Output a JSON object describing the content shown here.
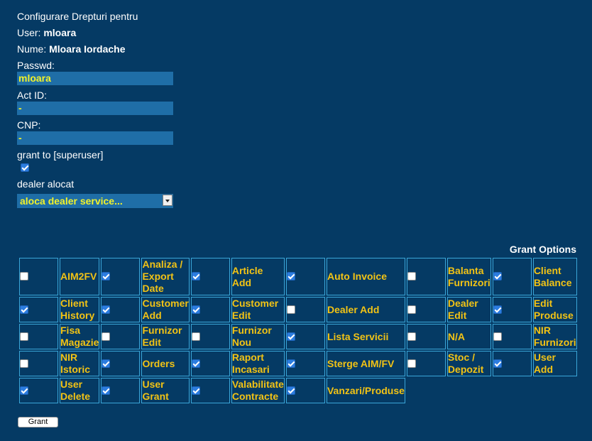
{
  "form": {
    "heading": "Configurare Drepturi pentru",
    "user_label": "User:",
    "user_value": "mloara",
    "name_label": "Nume:",
    "name_value": "Mloara Iordache",
    "passwd_label": "Passwd:",
    "passwd_value": "mloara",
    "actid_label": "Act ID:",
    "actid_value": "-",
    "cnp_label": "CNP:",
    "cnp_value": "-",
    "superuser_label": "grant to [superuser]",
    "superuser_checked": true,
    "dealer_label": "dealer alocat",
    "dealer_selected": "aloca dealer service..."
  },
  "grant_options": {
    "title": "Grant Options",
    "rows": [
      [
        {
          "label": "AIM2FV",
          "checked": false
        },
        {
          "label": "Analiza / Export Date",
          "checked": true
        },
        {
          "label": "Article Add",
          "checked": true
        },
        {
          "label": "Auto Invoice",
          "checked": true
        },
        {
          "label": "Balanta Furnizori",
          "checked": false
        },
        {
          "label": "Client Balance",
          "checked": true
        }
      ],
      [
        {
          "label": "Client History",
          "checked": true
        },
        {
          "label": "Customer Add",
          "checked": true
        },
        {
          "label": "Customer Edit",
          "checked": true
        },
        {
          "label": "Dealer Add",
          "checked": false
        },
        {
          "label": "Dealer Edit",
          "checked": false
        },
        {
          "label": "Edit Produse",
          "checked": true
        }
      ],
      [
        {
          "label": "Fisa Magazie",
          "checked": false
        },
        {
          "label": "Furnizor Edit",
          "checked": false
        },
        {
          "label": "Furnizor Nou",
          "checked": false
        },
        {
          "label": "Lista Servicii",
          "checked": true
        },
        {
          "label": "N/A",
          "checked": false
        },
        {
          "label": "NIR Furnizori",
          "checked": false
        }
      ],
      [
        {
          "label": "NIR Istoric",
          "checked": false
        },
        {
          "label": "Orders",
          "checked": true
        },
        {
          "label": "Raport Incasari",
          "checked": true
        },
        {
          "label": "Sterge AIM/FV",
          "checked": true
        },
        {
          "label": "Stoc / Depozit",
          "checked": false
        },
        {
          "label": "User Add",
          "checked": true
        }
      ],
      [
        {
          "label": "User Delete",
          "checked": true
        },
        {
          "label": "User Grant",
          "checked": true
        },
        {
          "label": "Valabilitate Contracte",
          "checked": true
        },
        {
          "label": "Vanzari/Produse",
          "checked": true
        }
      ]
    ]
  },
  "grant_button": "Grant",
  "colors": {
    "background": "#053a64",
    "input_bg": "#1f6ea7",
    "input_text": "#f2f22a",
    "option_label": "#f2c315",
    "cell_border": "#3aa6d8"
  }
}
